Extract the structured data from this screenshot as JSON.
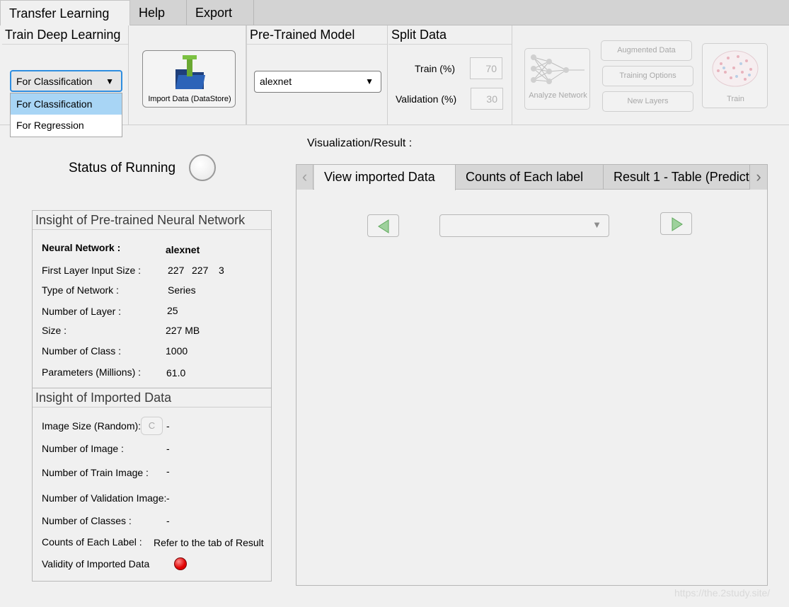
{
  "tabs": {
    "transfer": "Transfer Learning",
    "help": "Help",
    "export": "Export"
  },
  "ribbon": {
    "train_title": "Train Deep Learning",
    "task_select": {
      "value": "For Classification",
      "options": [
        "For Classification",
        "For Regression"
      ]
    },
    "import_button": "Import Data (DataStore)",
    "pretrained_title": "Pre-Trained Model",
    "model_select": "alexnet",
    "split_title": "Split Data",
    "train_label": "Train (%)",
    "train_value": "70",
    "val_label": "Validation (%)",
    "val_value": "30",
    "analyze_button": "Analyze Network",
    "augmented_button": "Augmented Data",
    "training_options_button": "Training Options",
    "new_layers_button": "New Layers",
    "train_button": "Train"
  },
  "status": {
    "label": "Status of Running"
  },
  "network_panel": {
    "title": "Insight of Pre-trained Neural Network",
    "nn_label": "Neural Network :",
    "nn_value": "alexnet",
    "input_label": "First Layer Input Size :",
    "input_v1": "227",
    "input_v2": "227",
    "input_v3": "3",
    "type_label": "Type of Network :",
    "type_value": "Series",
    "layers_label": "Number of Layer :",
    "layers_value": "25",
    "size_label": "Size :",
    "size_value": "227 MB",
    "classes_label": "Number of Class :",
    "classes_value": "1000",
    "params_label": "Parameters (Millions) :",
    "params_value": "61.0"
  },
  "data_panel": {
    "title": "Insight of Imported Data",
    "imgsize_label": "Image Size (Random):",
    "imgsize_button": "C",
    "imgsize_value": "-",
    "numimg_label": "Number of Image :",
    "numimg_value": "-",
    "numtrain_label": "Number of Train Image :",
    "numtrain_value": "-",
    "numval_label": "Number of Validation Image:",
    "numval_value": "-",
    "numclass_label": "Number of Classes :",
    "numclass_value": "-",
    "counts_label": "Counts of Each Label :",
    "counts_value": "Refer to the tab of Result",
    "validity_label": "Validity of  Imported Data",
    "validity_color": "#e00000"
  },
  "viz": {
    "title": "Visualization/Result :",
    "tabs": [
      "View imported Data",
      "Counts of Each label",
      "Result 1 - Table (Predict"
    ]
  },
  "watermark": "https://the.2study.site/"
}
